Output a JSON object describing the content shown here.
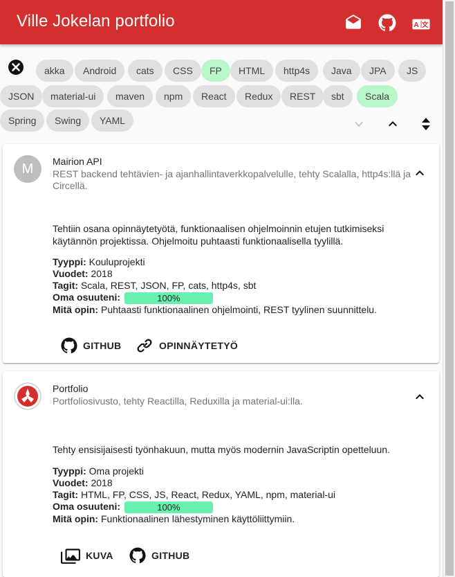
{
  "app": {
    "title": "Ville Jokelan portfolio"
  },
  "toolbar": {
    "icons": [
      "mail-open-icon",
      "github-icon",
      "translate-icon"
    ]
  },
  "filter_chips": [
    {
      "label": "akka",
      "active": false
    },
    {
      "label": "Android",
      "active": false
    },
    {
      "label": "cats",
      "active": false
    },
    {
      "label": "CSS",
      "active": false
    },
    {
      "label": "FP",
      "active": true
    },
    {
      "label": "HTML",
      "active": false
    },
    {
      "label": "http4s",
      "active": false
    },
    {
      "label": "Java",
      "active": false
    },
    {
      "label": "JPA",
      "active": false
    },
    {
      "label": "JS",
      "active": false
    },
    {
      "label": "JSON",
      "active": false
    },
    {
      "label": "material-ui",
      "active": false
    },
    {
      "label": "maven",
      "active": false
    },
    {
      "label": "npm",
      "active": false
    },
    {
      "label": "React",
      "active": false
    },
    {
      "label": "Redux",
      "active": false
    },
    {
      "label": "REST",
      "active": false
    },
    {
      "label": "sbt",
      "active": false
    },
    {
      "label": "Scala",
      "active": true
    },
    {
      "label": "Spring",
      "active": false
    },
    {
      "label": "Swing",
      "active": false
    },
    {
      "label": "YAML",
      "active": false
    }
  ],
  "colors": {
    "appbar": "#d32f2f",
    "chip": "#e0e0e0",
    "chip_active": "#b9f6ca",
    "progress": "#69f0ae"
  },
  "labels": {
    "type": "Tyyppi:",
    "years": "Vuodet:",
    "tags": "Tagit:",
    "share": "Oma osuuteni:",
    "learned": "Mitä opin:"
  },
  "projects": [
    {
      "avatar_letter": "M",
      "title": "Mairion API",
      "subtitle": "REST backend tehtävien- ja ajanhallintaverkkopalvelulle, tehty Scalalla, http4s:llä ja Circellä.",
      "description": "Tehtiin osana opinnäytetyötä, funktionaalisen ohjelmoinnin etujen tutkimiseksi käytännön projektissa. Ohjelmoitu puhtaasti funktionaalisella tyylillä.",
      "type": "Kouluprojekti",
      "years": "2018",
      "tags": "Scala, REST, JSON, FP, cats, http4s, sbt",
      "share": "100%",
      "share_value": 100,
      "learned": "Puhtaasti funktionaalinen ohjelmointi, REST tyylinen suunnittelu.",
      "actions": [
        "GITHUB",
        "OPINNÄYTETYÖ"
      ]
    },
    {
      "avatar_letter": "",
      "title": "Portfolio",
      "subtitle": "Portfoliosivusto, tehty Reactilla, Reduxilla ja material-ui:lla.",
      "description": "Tehty ensisijaisesti työnhakuun, mutta myös modernin JavaScriptin opetteluun.",
      "type": "Oma projekti",
      "years": "2018",
      "tags": "HTML, FP, CSS, JS, React, Redux, YAML, npm, material-ui",
      "share": "100%",
      "share_value": 100,
      "learned": "Funktionaalinen lähestyminen käyttöliittymiin.",
      "actions": [
        "KUVA",
        "GITHUB"
      ]
    }
  ]
}
